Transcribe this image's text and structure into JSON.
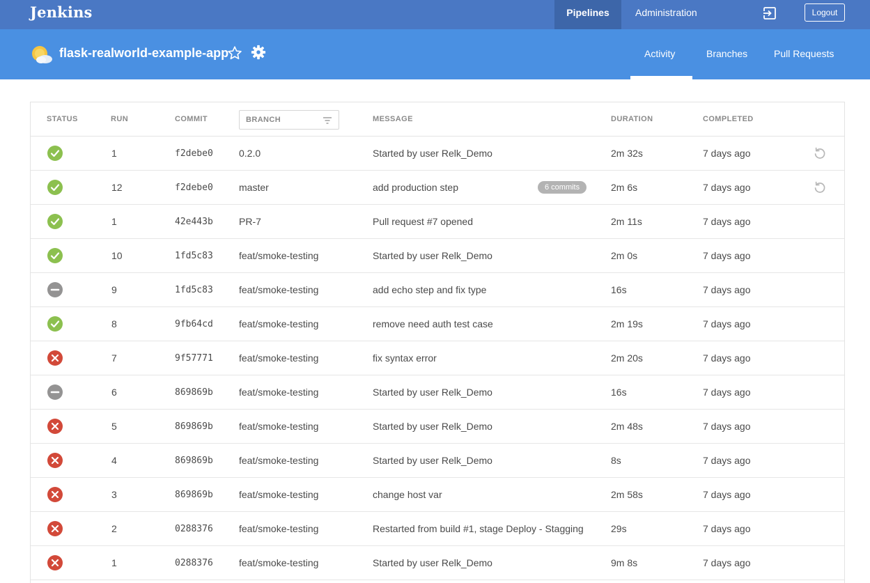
{
  "topbar": {
    "brand": "Jenkins",
    "nav_pipelines": "Pipelines",
    "nav_administration": "Administration",
    "logout": "Logout"
  },
  "pipeline": {
    "title": "flask-realworld-example-app",
    "tabs": [
      "Activity",
      "Branches",
      "Pull Requests"
    ],
    "active_tab": "Activity"
  },
  "table": {
    "headers": {
      "status": "STATUS",
      "run": "RUN",
      "commit": "COMMIT",
      "branch": "BRANCH",
      "message": "MESSAGE",
      "duration": "DURATION",
      "completed": "COMPLETED"
    },
    "rows": [
      {
        "status": "success",
        "run": "1",
        "commit": "f2debe0",
        "branch": "0.2.0",
        "message": "Started by user Relk_Demo",
        "badge": "",
        "duration": "2m 32s",
        "completed": "7 days ago",
        "replay": true
      },
      {
        "status": "success",
        "run": "12",
        "commit": "f2debe0",
        "branch": "master",
        "message": "add production step",
        "badge": "6 commits",
        "duration": "2m 6s",
        "completed": "7 days ago",
        "replay": true
      },
      {
        "status": "success",
        "run": "1",
        "commit": "42e443b",
        "branch": "PR-7",
        "message": "Pull request #7 opened",
        "badge": "",
        "duration": "2m 11s",
        "completed": "7 days ago",
        "replay": false
      },
      {
        "status": "success",
        "run": "10",
        "commit": "1fd5c83",
        "branch": "feat/smoke-testing",
        "message": "Started by user Relk_Demo",
        "badge": "",
        "duration": "2m 0s",
        "completed": "7 days ago",
        "replay": false
      },
      {
        "status": "aborted",
        "run": "9",
        "commit": "1fd5c83",
        "branch": "feat/smoke-testing",
        "message": "add echo step and fix type",
        "badge": "",
        "duration": "16s",
        "completed": "7 days ago",
        "replay": false
      },
      {
        "status": "success",
        "run": "8",
        "commit": "9fb64cd",
        "branch": "feat/smoke-testing",
        "message": "remove need auth test case",
        "badge": "",
        "duration": "2m 19s",
        "completed": "7 days ago",
        "replay": false
      },
      {
        "status": "failure",
        "run": "7",
        "commit": "9f57771",
        "branch": "feat/smoke-testing",
        "message": "fix syntax error",
        "badge": "",
        "duration": "2m 20s",
        "completed": "7 days ago",
        "replay": false
      },
      {
        "status": "aborted",
        "run": "6",
        "commit": "869869b",
        "branch": "feat/smoke-testing",
        "message": "Started by user Relk_Demo",
        "badge": "",
        "duration": "16s",
        "completed": "7 days ago",
        "replay": false
      },
      {
        "status": "failure",
        "run": "5",
        "commit": "869869b",
        "branch": "feat/smoke-testing",
        "message": "Started by user Relk_Demo",
        "badge": "",
        "duration": "2m 48s",
        "completed": "7 days ago",
        "replay": false
      },
      {
        "status": "failure",
        "run": "4",
        "commit": "869869b",
        "branch": "feat/smoke-testing",
        "message": "Started by user Relk_Demo",
        "badge": "",
        "duration": "8s",
        "completed": "7 days ago",
        "replay": false
      },
      {
        "status": "failure",
        "run": "3",
        "commit": "869869b",
        "branch": "feat/smoke-testing",
        "message": "change host var",
        "badge": "",
        "duration": "2m 58s",
        "completed": "7 days ago",
        "replay": false
      },
      {
        "status": "failure",
        "run": "2",
        "commit": "0288376",
        "branch": "feat/smoke-testing",
        "message": "Restarted from build #1, stage Deploy - Stagging",
        "badge": "",
        "duration": "29s",
        "completed": "7 days ago",
        "replay": false
      },
      {
        "status": "failure",
        "run": "1",
        "commit": "0288376",
        "branch": "feat/smoke-testing",
        "message": "Started by user Relk_Demo",
        "badge": "",
        "duration": "9m 8s",
        "completed": "7 days ago",
        "replay": false
      }
    ]
  },
  "colors": {
    "topbar": "#4a78c4",
    "subheader": "#4a90e2",
    "success": "#8cc04f",
    "failure": "#d24939",
    "aborted": "#949393"
  },
  "icons": {
    "status_success": "check-circle-icon",
    "status_failure": "x-circle-icon",
    "status_aborted": "minus-circle-icon",
    "replay": "replay-icon",
    "logout": "exit-icon",
    "favorite": "star-icon",
    "settings": "gear-icon",
    "health": "weather-icon",
    "filter": "filter-icon"
  }
}
